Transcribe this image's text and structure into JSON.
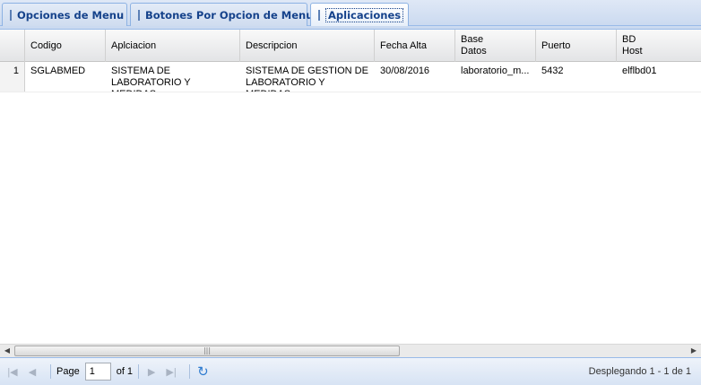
{
  "tabs": [
    {
      "label": "Opciones de Menu",
      "icon": "table-icon",
      "active": false
    },
    {
      "label": "Botones Por Opcion de Menu",
      "icon": "table-icon",
      "active": false
    },
    {
      "label": "Aplicaciones",
      "icon": "table-icon",
      "active": true
    }
  ],
  "grid": {
    "columns": [
      "Codigo",
      "Aplciacion",
      "Descripcion",
      "Fecha Alta",
      "Base\nDatos",
      "Puerto",
      "BD\nHost"
    ],
    "rows": [
      {
        "rownum": "1",
        "codigo": "SGLABMED",
        "aplicacion": "SISTEMA DE LABORATORIO Y MEDIDAS",
        "descripcion": "SISTEMA DE GESTION DE LABORATORIO Y MEDIDAS",
        "fecha_alta": "30/08/2016",
        "base_datos": "laboratorio_m...",
        "puerto": "5432",
        "bd_host": "elflbd01"
      }
    ]
  },
  "pager": {
    "page_label": "Page",
    "page_value": "1",
    "of_label": "of 1",
    "display_msg": "Desplegando 1 - 1 de 1"
  },
  "colors": {
    "tab_text": "#15428b",
    "border": "#99bbe8",
    "refresh": "#2e7bcf"
  }
}
